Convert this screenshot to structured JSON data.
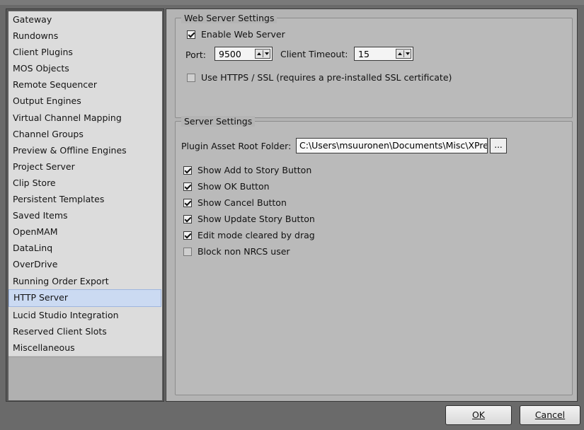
{
  "sidebar": {
    "items": [
      {
        "label": "Gateway"
      },
      {
        "label": "Rundowns"
      },
      {
        "label": "Client Plugins"
      },
      {
        "label": "MOS Objects"
      },
      {
        "label": "Remote Sequencer"
      },
      {
        "label": "Output Engines"
      },
      {
        "label": "Virtual Channel Mapping"
      },
      {
        "label": "Channel Groups"
      },
      {
        "label": "Preview & Offline Engines"
      },
      {
        "label": "Project Server"
      },
      {
        "label": "Clip Store"
      },
      {
        "label": "Persistent Templates"
      },
      {
        "label": "Saved Items"
      },
      {
        "label": "OpenMAM"
      },
      {
        "label": "DataLinq"
      },
      {
        "label": "OverDrive"
      },
      {
        "label": "Running Order Export"
      },
      {
        "label": "HTTP Server"
      },
      {
        "label": "Lucid Studio Integration"
      },
      {
        "label": "Reserved Client Slots"
      },
      {
        "label": "Miscellaneous"
      }
    ],
    "selected": "HTTP Server"
  },
  "web_server": {
    "legend": "Web Server Settings",
    "enable_label": "Enable Web Server",
    "enable_checked": true,
    "port_label": "Port:",
    "port_value": "9500",
    "timeout_label": "Client Timeout:",
    "timeout_value": "15",
    "https_label": "Use HTTPS / SSL (requires a pre-installed SSL certificate)",
    "https_checked": false
  },
  "server_settings": {
    "legend": "Server Settings",
    "plugin_folder_label": "Plugin Asset Root Folder:",
    "plugin_folder_value": "C:\\Users\\msuuronen\\Documents\\Misc\\XPre",
    "browse_label": "...",
    "options": [
      {
        "label": "Show Add to Story Button",
        "checked": true
      },
      {
        "label": "Show OK Button",
        "checked": true
      },
      {
        "label": "Show Cancel Button",
        "checked": true
      },
      {
        "label": "Show Update Story Button",
        "checked": true
      },
      {
        "label": "Edit mode cleared by drag",
        "checked": true
      },
      {
        "label": "Block non NRCS user",
        "checked": false
      }
    ]
  },
  "buttons": {
    "ok_label": "OK",
    "cancel_label": "Cancel"
  }
}
